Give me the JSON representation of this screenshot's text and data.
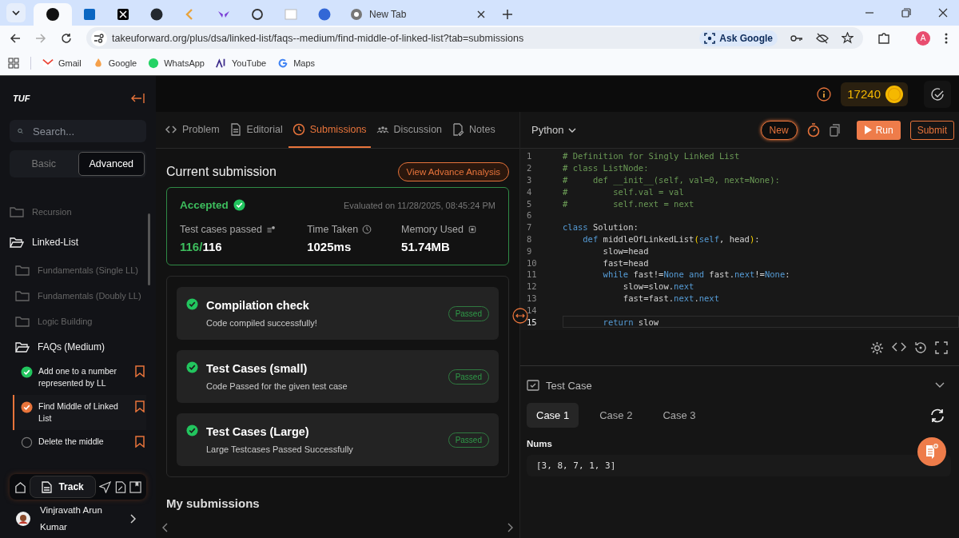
{
  "browser": {
    "tabs": [
      {
        "selected": true
      },
      {
        "selected": false
      },
      {
        "selected": false
      },
      {
        "selected": false
      },
      {
        "selected": false
      },
      {
        "selected": false
      },
      {
        "selected": false
      },
      {
        "selected": false
      },
      {
        "selected": false
      },
      {
        "title": "New Tab",
        "selected": false
      }
    ],
    "url": "takeuforward.org/plus/dsa/linked-list/faqs--medium/find-middle-of-linked-list?tab=submissions",
    "ask_google": "Ask Google",
    "profile_initial": "A",
    "bookmarks": [
      "Gmail",
      "Google",
      "WhatsApp",
      "YouTube",
      "Maps"
    ]
  },
  "sidebar": {
    "logo": "TUF",
    "search": {
      "placeholder": "Search..."
    },
    "modes": [
      {
        "label": "Basic",
        "selected": false
      },
      {
        "label": "Advanced",
        "selected": true
      }
    ],
    "tree": [
      {
        "label": "Recursion",
        "expanded": false
      },
      {
        "label": "Linked-List",
        "expanded": true,
        "children": [
          {
            "label": "Fundamentals (Single LL)",
            "expanded": false
          },
          {
            "label": "Fundamentals (Doubly LL)",
            "expanded": false
          },
          {
            "label": "Logic Building",
            "expanded": false
          },
          {
            "label": "FAQs (Medium)",
            "expanded": true,
            "problems": [
              {
                "label": "Add one to a number represented by LL",
                "kind": "solved",
                "selected": false
              },
              {
                "label": "Find Middle of Linked List",
                "kind": "current",
                "selected": true
              },
              {
                "label": "Delete the middle",
                "kind": "todo",
                "selected": false
              }
            ]
          }
        ]
      }
    ],
    "nav": {
      "track": "Track"
    },
    "user": "Vinjravath Arun Kumar"
  },
  "header": {
    "coins": "17240"
  },
  "problem_tabs": [
    {
      "label": "Problem",
      "selected": false
    },
    {
      "label": "Editorial",
      "selected": false
    },
    {
      "label": "Submissions",
      "selected": true
    },
    {
      "label": "Discussion",
      "selected": false
    },
    {
      "label": "Notes",
      "selected": false
    }
  ],
  "submission": {
    "title": "Current submission",
    "analysis_button": "View Advance Analysis",
    "status": "Accepted",
    "evaluated": "Evaluated on 11/28/2025, 08:45:24 PM",
    "stats": [
      {
        "label": "Test cases passed",
        "passed": "116/",
        "total": "116"
      },
      {
        "label": "Time Taken",
        "value": "1025ms"
      },
      {
        "label": "Memory Used",
        "value": "51.74MB"
      }
    ],
    "checks": [
      {
        "title": "Compilation check",
        "detail": "Code compiled successfully!",
        "badge": "Passed"
      },
      {
        "title": "Test Cases (small)",
        "detail": "Code Passed for the given test case",
        "badge": "Passed"
      },
      {
        "title": "Test Cases (Large)",
        "detail": "Large Testcases Passed Successfully",
        "badge": "Passed"
      }
    ],
    "history_title": "My submissions"
  },
  "editor": {
    "language": "Python",
    "new_button": "New",
    "run_button": "Run",
    "submit_button": "Submit",
    "lines": [
      {
        "number": "1",
        "current": false,
        "tokens": [
          {
            "text": "# Definition for Singly Linked List",
            "kind": "comment"
          }
        ]
      },
      {
        "number": "2",
        "current": false,
        "tokens": [
          {
            "text": "# class ListNode:",
            "kind": "comment"
          }
        ]
      },
      {
        "number": "3",
        "current": false,
        "tokens": [
          {
            "text": "#     def __init__(self, val=0, next=None):",
            "kind": "comment"
          }
        ]
      },
      {
        "number": "4",
        "current": false,
        "tokens": [
          {
            "text": "#         self.val = val",
            "kind": "comment"
          }
        ]
      },
      {
        "number": "5",
        "current": false,
        "tokens": [
          {
            "text": "#         self.next = next",
            "kind": "comment"
          }
        ]
      },
      {
        "number": "6",
        "current": false
      },
      {
        "number": "7",
        "current": false,
        "tokens": [
          {
            "text": "class",
            "kind": "keyword"
          },
          {
            "text": " Solution:",
            "kind": "plain"
          }
        ]
      },
      {
        "number": "8",
        "current": false,
        "tokens": [
          {
            "text": "    def",
            "kind": "keyword"
          },
          {
            "text": " middleOfLinkedList",
            "kind": "plain"
          },
          {
            "text": "(",
            "kind": "paren"
          },
          {
            "text": "self",
            "kind": "keyword"
          },
          {
            "text": ", head",
            "kind": "plain"
          },
          {
            "text": ")",
            "kind": "paren"
          },
          {
            "text": ":",
            "kind": "plain"
          }
        ]
      },
      {
        "number": "9",
        "current": false,
        "tokens": [
          {
            "text": "        slow=head",
            "kind": "plain"
          }
        ]
      },
      {
        "number": "10",
        "current": false,
        "tokens": [
          {
            "text": "        fast=head",
            "kind": "plain"
          }
        ]
      },
      {
        "number": "11",
        "current": false,
        "tokens": [
          {
            "text": "        while",
            "kind": "keyword"
          },
          {
            "text": " fast!=",
            "kind": "plain"
          },
          {
            "text": "None",
            "kind": "keyword"
          },
          {
            "text": " and",
            "kind": "keyword"
          },
          {
            "text": " fast.",
            "kind": "plain"
          },
          {
            "text": "next",
            "kind": "keyword"
          },
          {
            "text": "!=",
            "kind": "plain"
          },
          {
            "text": "None",
            "kind": "keyword"
          },
          {
            "text": ":",
            "kind": "plain"
          }
        ]
      },
      {
        "number": "12",
        "current": false,
        "tokens": [
          {
            "text": "            slow=slow.",
            "kind": "plain"
          },
          {
            "text": "next",
            "kind": "keyword"
          }
        ]
      },
      {
        "number": "13",
        "current": false,
        "tokens": [
          {
            "text": "            fast=fast.",
            "kind": "plain"
          },
          {
            "text": "next",
            "kind": "keyword"
          },
          {
            "text": ".",
            "kind": "plain"
          },
          {
            "text": "next",
            "kind": "keyword"
          }
        ]
      },
      {
        "number": "14",
        "current": false
      },
      {
        "number": "15",
        "current": true,
        "tokens": [
          {
            "text": "        return",
            "kind": "keyword"
          },
          {
            "text": " slow",
            "kind": "plain"
          }
        ]
      }
    ]
  },
  "testcase": {
    "title": "Test Case",
    "cases": [
      {
        "label": "Case 1",
        "selected": true
      },
      {
        "label": "Case 2",
        "selected": false
      },
      {
        "label": "Case 3",
        "selected": false
      }
    ],
    "input_label": "Nums",
    "input_value": "[3, 8, 7, 1, 3]"
  }
}
